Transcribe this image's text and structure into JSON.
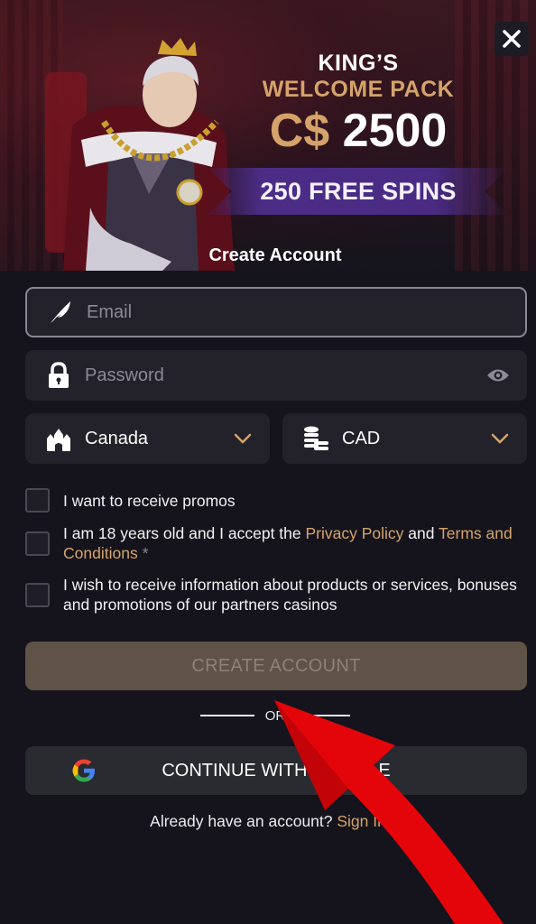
{
  "promo": {
    "line1": "KING’S",
    "line2": "WELCOME PACK",
    "currency": "C$",
    "amount": "2500",
    "spins": "250 FREE SPINS"
  },
  "form": {
    "title": "Create Account",
    "email_placeholder": "Email",
    "password_placeholder": "Password",
    "country": "Canada",
    "currency": "CAD"
  },
  "checks": {
    "promos": "I want to receive promos",
    "age_prefix": "I am 18 years old and I accept the ",
    "privacy": "Privacy Policy",
    "and": " and ",
    "terms": "Terms and Conditions",
    "required_mark": "*",
    "partners": "I wish to receive information about products or services, bonuses and promotions of our partners casinos"
  },
  "buttons": {
    "create": "CREATE ACCOUNT",
    "or": "OR",
    "google": "CONTINUE WITH GOOGLE"
  },
  "signin": {
    "prefix": "Already have an account? ",
    "link": "Sign In"
  },
  "colors": {
    "accent_gold": "#d5a36a",
    "banner_purple": "#4b2d86",
    "arrow_red": "#e3050a"
  }
}
